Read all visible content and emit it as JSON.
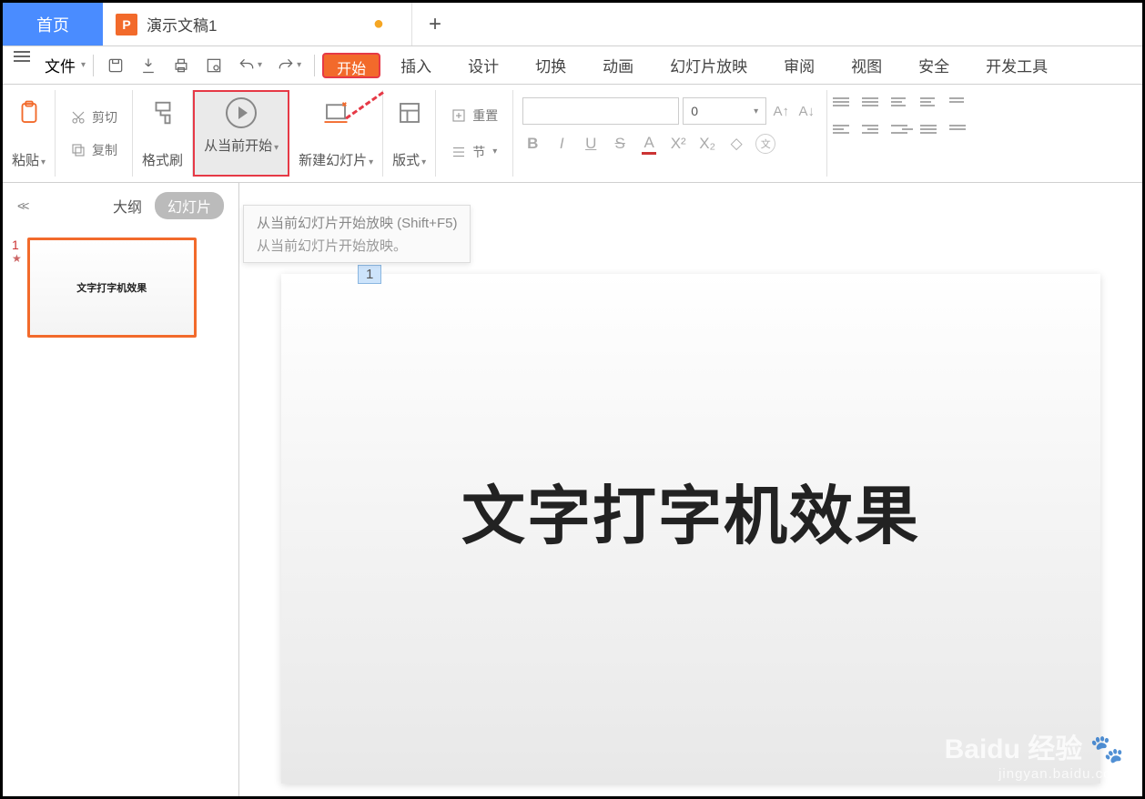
{
  "tabs": {
    "home": "首页",
    "doc_title": "演示文稿1",
    "doc_icon_letter": "P"
  },
  "menubar": {
    "file": "文件",
    "tabs": [
      "插入",
      "设计",
      "切换",
      "动画",
      "幻灯片放映",
      "审阅",
      "视图",
      "安全",
      "开发工具"
    ],
    "start": "开始"
  },
  "ribbon": {
    "paste": "粘贴",
    "cut": "剪切",
    "copy": "复制",
    "format_painter": "格式刷",
    "start_from_current": "从当前开始",
    "new_slide": "新建幻灯片",
    "layout": "版式",
    "reset": "重置",
    "section": "节",
    "font_size": "0",
    "wen": "文"
  },
  "tooltip": {
    "title": "从当前幻灯片开始放映 (Shift+F5)",
    "desc": "从当前幻灯片开始放映。"
  },
  "side": {
    "outline": "大纲",
    "slides": "幻灯片",
    "thumb_num": "1",
    "thumb_marker": "★"
  },
  "slide": {
    "placeholder_num": "1",
    "title": "文字打字机效果"
  },
  "watermark": {
    "brand": "Baidu 经验",
    "url": "jingyan.baidu.com"
  }
}
